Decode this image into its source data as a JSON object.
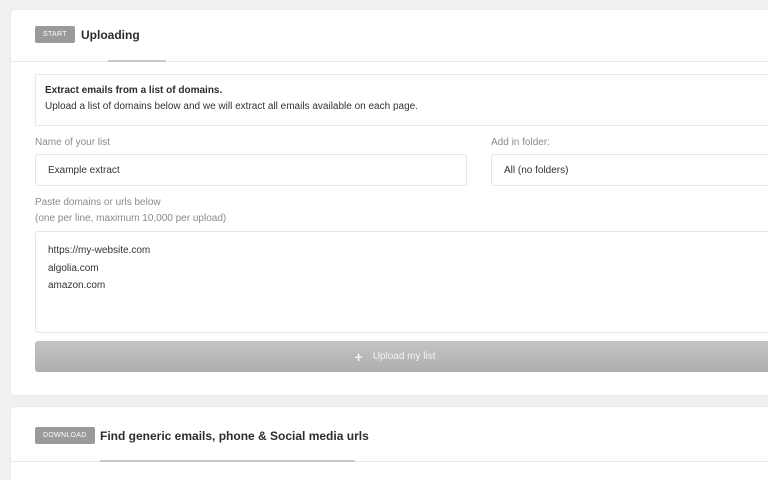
{
  "upload_section": {
    "badge": "START",
    "title": "Uploading",
    "info_title": "Extract emails from a list of domains.",
    "info_text": "Upload a list of domains below and we will extract all emails available on each page.",
    "list_name_label": "Name of your list",
    "list_name_value": "Example extract",
    "folder_label": "Add in folder:",
    "folder_value": "All (no folders)",
    "paste_label": "Paste domains or urls below",
    "paste_hint": "(one per line, maximum 10,000 per upload)",
    "domains": [
      "https://my-website.com",
      "algolia.com",
      "amazon.com"
    ],
    "upload_button": "Upload my list"
  },
  "download_section": {
    "badge": "DOWNLOAD",
    "title": "Find generic emails, phone & Social media urls"
  }
}
